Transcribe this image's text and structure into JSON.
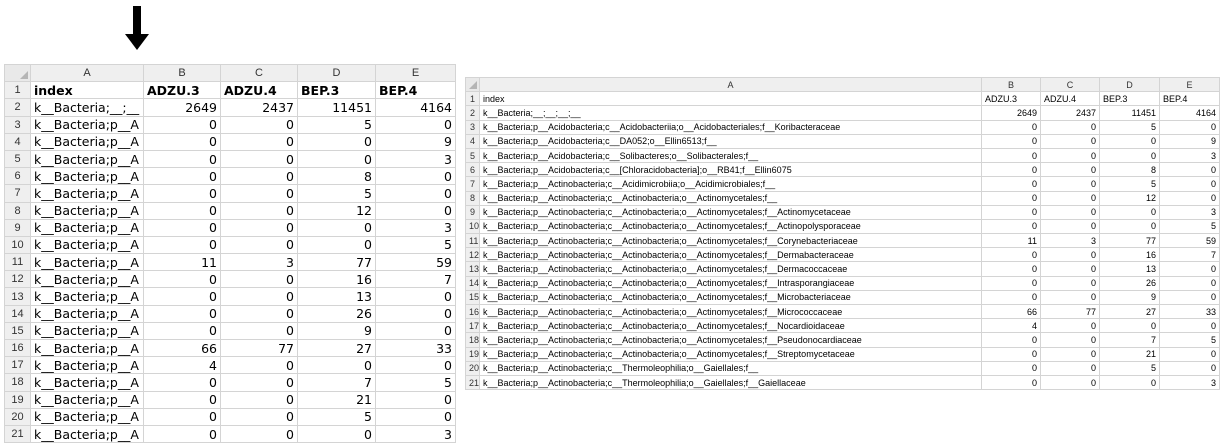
{
  "columns": [
    "A",
    "B",
    "C",
    "D",
    "E"
  ],
  "header_row": {
    "num": "1",
    "a": "index",
    "b": "ADZU.3",
    "c": "ADZU.4",
    "d": "BEP.3",
    "e": "BEP.4"
  },
  "rows": [
    {
      "num": "2",
      "short": "k__Bacteria;__;__",
      "full": "k__Bacteria;__;__;__;__",
      "b": "2649",
      "c": "2437",
      "d": "11451",
      "e": "4164"
    },
    {
      "num": "3",
      "short": "k__Bacteria;p__A",
      "full": "k__Bacteria;p__Acidobacteria;c__Acidobacteriia;o__Acidobacteriales;f__Koribacteraceae",
      "b": "0",
      "c": "0",
      "d": "5",
      "e": "0"
    },
    {
      "num": "4",
      "short": "k__Bacteria;p__A",
      "full": "k__Bacteria;p__Acidobacteria;c__DA052;o__Ellin6513;f__",
      "b": "0",
      "c": "0",
      "d": "0",
      "e": "9"
    },
    {
      "num": "5",
      "short": "k__Bacteria;p__A",
      "full": "k__Bacteria;p__Acidobacteria;c__Solibacteres;o__Solibacterales;f__",
      "b": "0",
      "c": "0",
      "d": "0",
      "e": "3"
    },
    {
      "num": "6",
      "short": "k__Bacteria;p__A",
      "full": "k__Bacteria;p__Acidobacteria;c__[Chloracidobacteria];o__RB41;f__Ellin6075",
      "b": "0",
      "c": "0",
      "d": "8",
      "e": "0"
    },
    {
      "num": "7",
      "short": "k__Bacteria;p__A",
      "full": "k__Bacteria;p__Actinobacteria;c__Acidimicrobiia;o__Acidimicrobiales;f__",
      "b": "0",
      "c": "0",
      "d": "5",
      "e": "0"
    },
    {
      "num": "8",
      "short": "k__Bacteria;p__A",
      "full": "k__Bacteria;p__Actinobacteria;c__Actinobacteria;o__Actinomycetales;f__",
      "b": "0",
      "c": "0",
      "d": "12",
      "e": "0"
    },
    {
      "num": "9",
      "short": "k__Bacteria;p__A",
      "full": "k__Bacteria;p__Actinobacteria;c__Actinobacteria;o__Actinomycetales;f__Actinomycetaceae",
      "b": "0",
      "c": "0",
      "d": "0",
      "e": "3"
    },
    {
      "num": "10",
      "short": "k__Bacteria;p__A",
      "full": "k__Bacteria;p__Actinobacteria;c__Actinobacteria;o__Actinomycetales;f__Actinopolysporaceae",
      "b": "0",
      "c": "0",
      "d": "0",
      "e": "5"
    },
    {
      "num": "11",
      "short": "k__Bacteria;p__A",
      "full": "k__Bacteria;p__Actinobacteria;c__Actinobacteria;o__Actinomycetales;f__Corynebacteriaceae",
      "b": "11",
      "c": "3",
      "d": "77",
      "e": "59"
    },
    {
      "num": "12",
      "short": "k__Bacteria;p__A",
      "full": "k__Bacteria;p__Actinobacteria;c__Actinobacteria;o__Actinomycetales;f__Dermabacteraceae",
      "b": "0",
      "c": "0",
      "d": "16",
      "e": "7"
    },
    {
      "num": "13",
      "short": "k__Bacteria;p__A",
      "full": "k__Bacteria;p__Actinobacteria;c__Actinobacteria;o__Actinomycetales;f__Dermacoccaceae",
      "b": "0",
      "c": "0",
      "d": "13",
      "e": "0"
    },
    {
      "num": "14",
      "short": "k__Bacteria;p__A",
      "full": "k__Bacteria;p__Actinobacteria;c__Actinobacteria;o__Actinomycetales;f__Intrasporangiaceae",
      "b": "0",
      "c": "0",
      "d": "26",
      "e": "0"
    },
    {
      "num": "15",
      "short": "k__Bacteria;p__A",
      "full": "k__Bacteria;p__Actinobacteria;c__Actinobacteria;o__Actinomycetales;f__Microbacteriaceae",
      "b": "0",
      "c": "0",
      "d": "9",
      "e": "0"
    },
    {
      "num": "16",
      "short": "k__Bacteria;p__A",
      "full": "k__Bacteria;p__Actinobacteria;c__Actinobacteria;o__Actinomycetales;f__Micrococcaceae",
      "b": "66",
      "c": "77",
      "d": "27",
      "e": "33"
    },
    {
      "num": "17",
      "short": "k__Bacteria;p__A",
      "full": "k__Bacteria;p__Actinobacteria;c__Actinobacteria;o__Actinomycetales;f__Nocardioidaceae",
      "b": "4",
      "c": "0",
      "d": "0",
      "e": "0"
    },
    {
      "num": "18",
      "short": "k__Bacteria;p__A",
      "full": "k__Bacteria;p__Actinobacteria;c__Actinobacteria;o__Actinomycetales;f__Pseudonocardiaceae",
      "b": "0",
      "c": "0",
      "d": "7",
      "e": "5"
    },
    {
      "num": "19",
      "short": "k__Bacteria;p__A",
      "full": "k__Bacteria;p__Actinobacteria;c__Actinobacteria;o__Actinomycetales;f__Streptomycetaceae",
      "b": "0",
      "c": "0",
      "d": "21",
      "e": "0"
    },
    {
      "num": "20",
      "short": "k__Bacteria;p__A",
      "full": "k__Bacteria;p__Actinobacteria;c__Thermoleophilia;o__Gaiellales;f__",
      "b": "0",
      "c": "0",
      "d": "5",
      "e": "0"
    },
    {
      "num": "21",
      "short": "k__Bacteria;p__A",
      "full": "k__Bacteria;p__Actinobacteria;c__Thermoleophilia;o__Gaiellales;f__Gaiellaceae",
      "b": "0",
      "c": "0",
      "d": "0",
      "e": "3"
    }
  ],
  "colors": {
    "header_bg": "#efefef",
    "grid": "#d4d4d4",
    "arrow": "#000000"
  },
  "icons": {
    "pointer": "down-arrow-icon"
  }
}
